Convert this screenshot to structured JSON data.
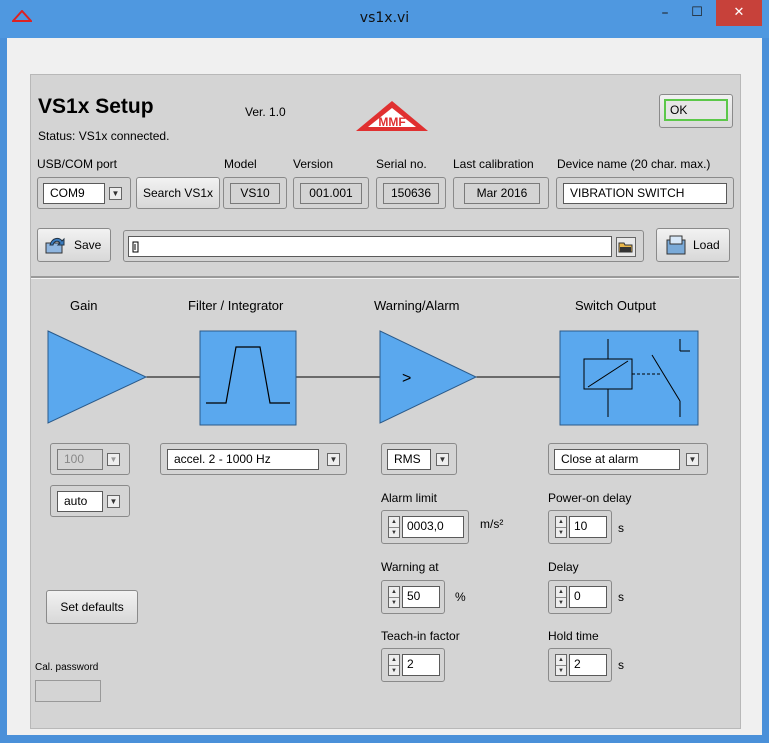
{
  "window": {
    "title": "vs1x.vi",
    "minimize": "–",
    "maximize": "☐",
    "close": "✕"
  },
  "header": {
    "title": "VS1x Setup",
    "version": "Ver. 1.0",
    "status": "Status:  VS1x connected.",
    "logo_text": "MMF",
    "ok_label": "OK"
  },
  "device": {
    "port_label": "USB/COM port",
    "port_value": "COM9",
    "search_label": "Search VS1x",
    "model_label": "Model",
    "model_value": "VS10",
    "version_label": "Version",
    "version_value": "001.001",
    "serial_label": "Serial no.",
    "serial_value": "150636",
    "calib_label": "Last calibration",
    "calib_value": "Mar  2016",
    "name_label": "Device name (20 char. max.)",
    "name_value": "VIBRATION SWITCH"
  },
  "file": {
    "save_label": "Save",
    "path_value": "",
    "load_label": "Load"
  },
  "sections": {
    "gain": "Gain",
    "filter": "Filter / Integrator",
    "warning": "Warning/Alarm",
    "switch": "Switch Output",
    "warn_symbol": ">"
  },
  "gain": {
    "value": "100",
    "mode": "auto"
  },
  "filter": {
    "value": "accel.  2 - 1000 Hz"
  },
  "alarm": {
    "mode": "RMS",
    "limit_label": "Alarm limit",
    "limit_value": "0003,0",
    "limit_unit": "m/s²",
    "warning_label": "Warning at",
    "warning_value": "50",
    "warning_unit": "%",
    "teach_label": "Teach-in factor",
    "teach_value": "2"
  },
  "switch": {
    "mode": "Close at alarm",
    "poweron_label": "Power-on delay",
    "poweron_value": "10",
    "poweron_unit": "s",
    "delay_label": "Delay",
    "delay_value": "0",
    "delay_unit": "s",
    "hold_label": "Hold time",
    "hold_value": "2",
    "hold_unit": "s"
  },
  "misc": {
    "defaults_label": "Set defaults",
    "password_label": "Cal. password",
    "password_value": ""
  },
  "colors": {
    "titlebar": "#4f98e0",
    "close": "#c7413a",
    "block": "#5aa8ee",
    "ok_border": "#5cc84a",
    "logo": "#e03030"
  }
}
